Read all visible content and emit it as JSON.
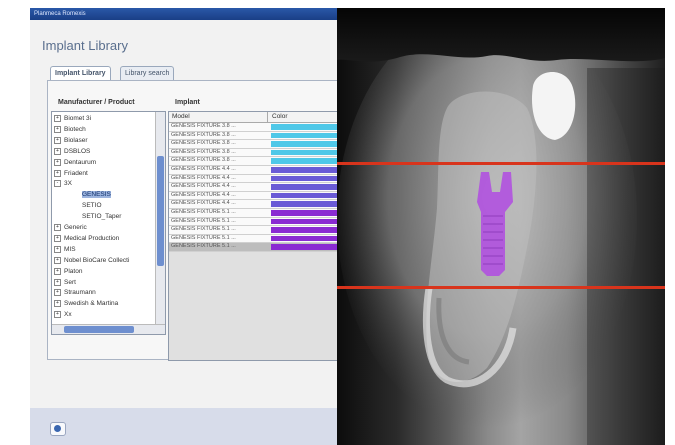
{
  "window": {
    "title": "Planmeca Romexis"
  },
  "dialog": {
    "heading": "Implant Library",
    "tabs": [
      {
        "label": "Implant Library",
        "active": true
      },
      {
        "label": "Library search",
        "active": false
      }
    ],
    "columns": {
      "manufacturer": "Manufacturer / Product",
      "implant": "Implant"
    },
    "tree": [
      {
        "label": "Biomet 3i",
        "expander": "+"
      },
      {
        "label": "Biotech",
        "expander": "+"
      },
      {
        "label": "Biolaser",
        "expander": "+"
      },
      {
        "label": "DSBLOS",
        "expander": "+"
      },
      {
        "label": "Dentaurum",
        "expander": "+"
      },
      {
        "label": "Friadent",
        "expander": "+"
      },
      {
        "label": "3X",
        "expander": "-"
      },
      {
        "label": "GENESIS",
        "selected": true,
        "leaf": true
      },
      {
        "label": "SETIO",
        "leaf": true
      },
      {
        "label": "SETIO_Taper",
        "leaf": true
      },
      {
        "label": "Generic",
        "expander": "+"
      },
      {
        "label": "Medical Production",
        "expander": "+"
      },
      {
        "label": "MIS",
        "expander": "+"
      },
      {
        "label": "Nobel BioCare Collecti",
        "expander": "+"
      },
      {
        "label": "Platon",
        "expander": "+"
      },
      {
        "label": "Sert",
        "expander": "+"
      },
      {
        "label": "Straumann",
        "expander": "+"
      },
      {
        "label": "Swedish & Martina",
        "expander": "+"
      },
      {
        "label": "Xx",
        "expander": "+"
      }
    ],
    "table": {
      "headers": {
        "model": "Model",
        "color": "Color"
      },
      "rows": [
        {
          "model": "GENESIS FIXTURE 3.8 ...",
          "color": "#4fc8e8"
        },
        {
          "model": "GENESIS FIXTURE 3.8 ...",
          "color": "#4fc8e8"
        },
        {
          "model": "GENESIS FIXTURE 3.8 ...",
          "color": "#4fc8e8"
        },
        {
          "model": "GENESIS FIXTURE 3.8 ...",
          "color": "#4fc8e8"
        },
        {
          "model": "GENESIS FIXTURE 3.8 ...",
          "color": "#4fc8e8"
        },
        {
          "model": "GENESIS FIXTURE 4.4 ...",
          "color": "#6a5bd6"
        },
        {
          "model": "GENESIS FIXTURE 4.4 ...",
          "color": "#6a5bd6"
        },
        {
          "model": "GENESIS FIXTURE 4.4 ...",
          "color": "#6a5bd6"
        },
        {
          "model": "GENESIS FIXTURE 4.4 ...",
          "color": "#6a5bd6"
        },
        {
          "model": "GENESIS FIXTURE 4.4 ...",
          "color": "#6a5bd6"
        },
        {
          "model": "GENESIS FIXTURE 5.1 ...",
          "color": "#8a2bd2"
        },
        {
          "model": "GENESIS FIXTURE 5.1 ...",
          "color": "#8a2bd2"
        },
        {
          "model": "GENESIS FIXTURE 5.1 ...",
          "color": "#8a2bd2"
        },
        {
          "model": "GENESIS FIXTURE 5.1 ...",
          "color": "#8a2bd2"
        },
        {
          "model": "GENESIS FIXTURE 5.1 ...",
          "color": "#8a2bd2",
          "selected": true
        }
      ]
    },
    "footer": {
      "help_icon": "help-icon"
    }
  },
  "xray": {
    "guide_line_color": "#d8341c",
    "implant_color": "#b04ee0"
  }
}
